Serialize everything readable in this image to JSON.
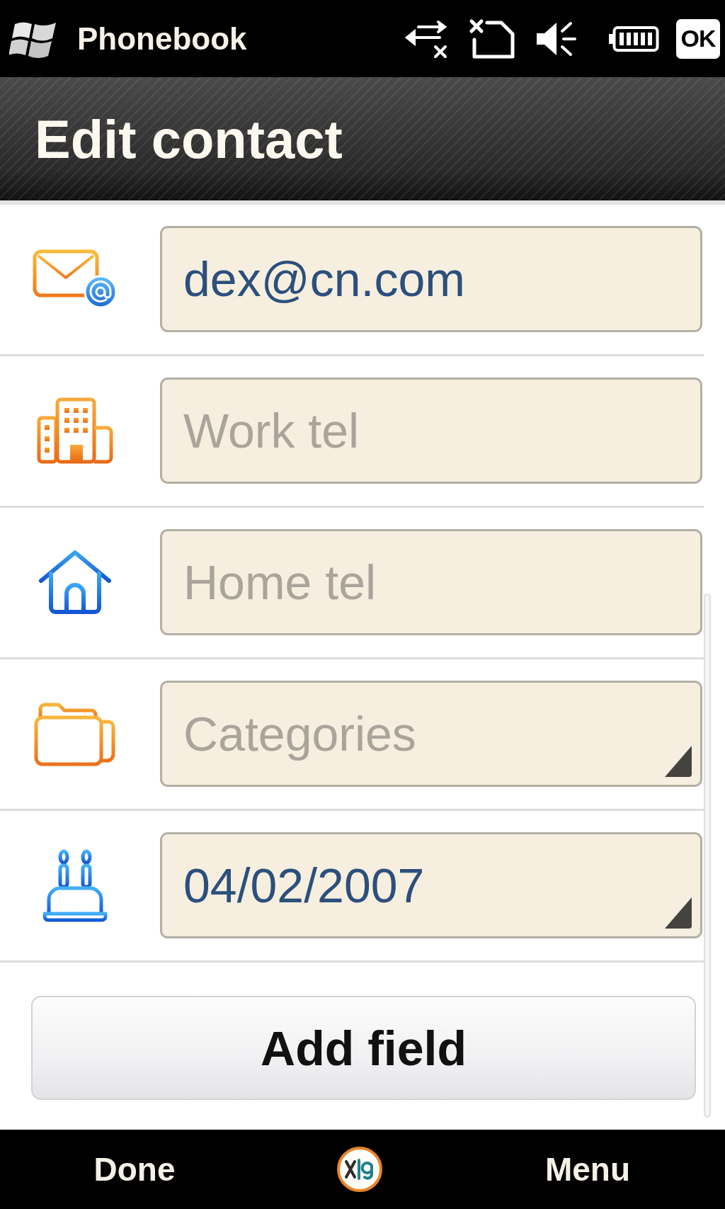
{
  "status_bar": {
    "app_name": "Phonebook",
    "ok_button": "OK"
  },
  "header": {
    "title": "Edit contact"
  },
  "fields": [
    {
      "kind": "email",
      "value": "dex@cn.com",
      "dropdown": false
    },
    {
      "kind": "work",
      "placeholder": "Work tel",
      "dropdown": false
    },
    {
      "kind": "home",
      "placeholder": "Home tel",
      "dropdown": false
    },
    {
      "kind": "category",
      "placeholder": "Categories",
      "dropdown": true
    },
    {
      "kind": "birthday",
      "value": "04/02/2007",
      "dropdown": true
    }
  ],
  "add_button": "Add field",
  "softkeys": {
    "left": "Done",
    "right": "Menu"
  }
}
